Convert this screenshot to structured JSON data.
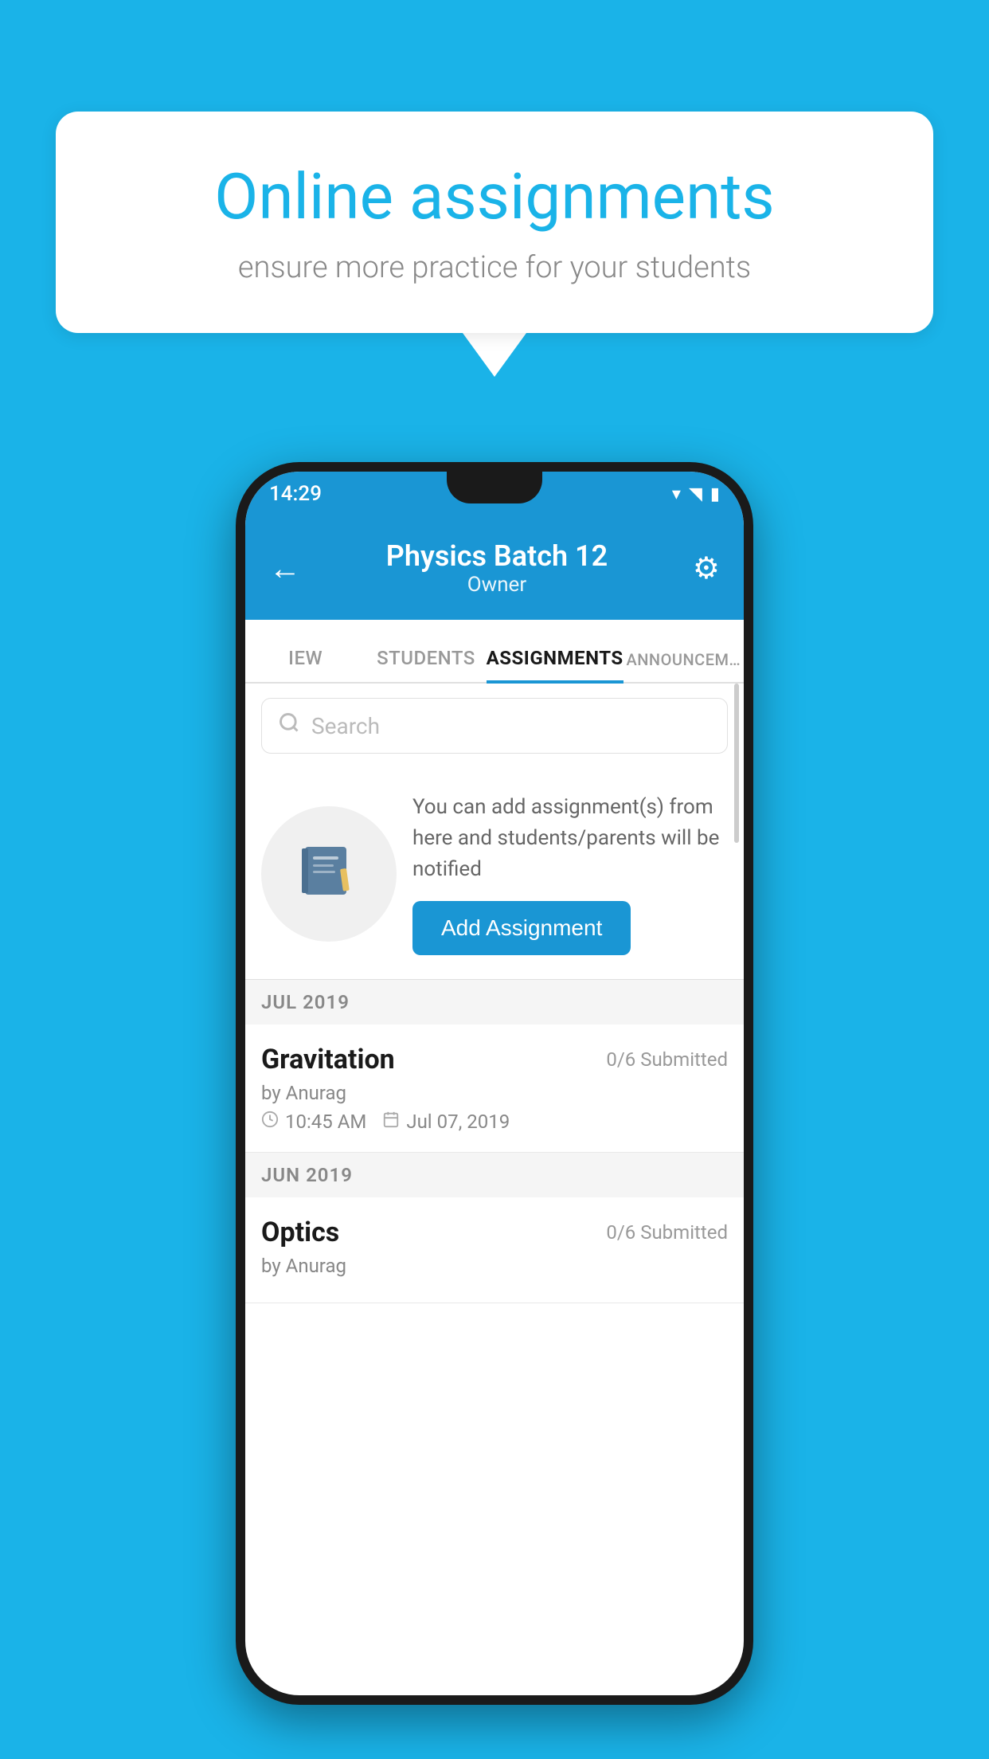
{
  "background": {
    "color": "#1ab3e8"
  },
  "speech_bubble": {
    "title": "Online assignments",
    "subtitle": "ensure more practice for your students"
  },
  "status_bar": {
    "time": "14:29",
    "wifi_icon": "▾",
    "signal_icon": "▲",
    "battery_icon": "▮"
  },
  "app_header": {
    "back_label": "←",
    "title": "Physics Batch 12",
    "subtitle": "Owner",
    "gear_label": "⚙"
  },
  "tabs": [
    {
      "label": "IEW",
      "active": false
    },
    {
      "label": "STUDENTS",
      "active": false
    },
    {
      "label": "ASSIGNMENTS",
      "active": true
    },
    {
      "label": "ANNOUNCEM…",
      "active": false
    }
  ],
  "search": {
    "placeholder": "Search"
  },
  "add_promo": {
    "icon_label": "📓",
    "description": "You can add assignment(s) from here and students/parents will be notified",
    "button_label": "Add Assignment"
  },
  "sections": [
    {
      "header": "JUL 2019",
      "assignments": [
        {
          "name": "Gravitation",
          "submitted": "0/6 Submitted",
          "by": "by Anurag",
          "time": "10:45 AM",
          "date": "Jul 07, 2019"
        }
      ]
    },
    {
      "header": "JUN 2019",
      "assignments": [
        {
          "name": "Optics",
          "submitted": "0/6 Submitted",
          "by": "by Anurag",
          "time": "",
          "date": ""
        }
      ]
    }
  ]
}
